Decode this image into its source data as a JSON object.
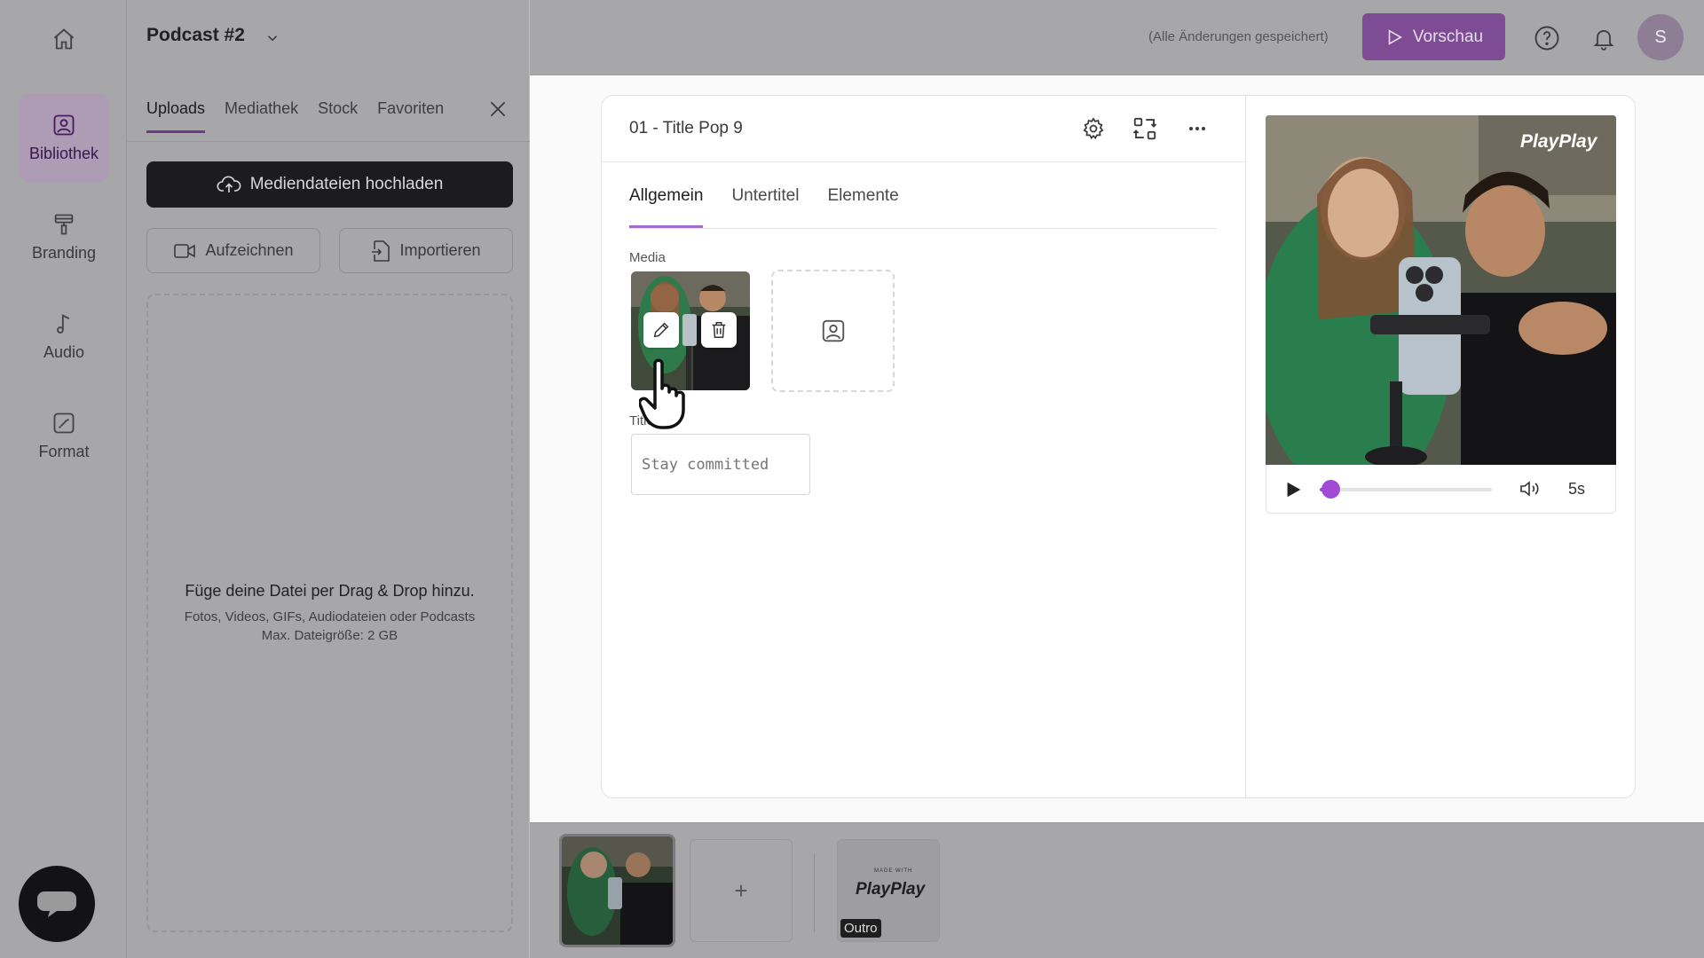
{
  "nav": {
    "home_icon": "home-icon",
    "items": [
      {
        "label": "Bibliothek",
        "icon": "library-icon",
        "active": true
      },
      {
        "label": "Branding",
        "icon": "paint-roller-icon"
      },
      {
        "label": "Audio",
        "icon": "music-note-icon"
      },
      {
        "label": "Format",
        "icon": "format-icon"
      }
    ],
    "chat_icon": "chat-bubble-icon"
  },
  "project": {
    "title": "Podcast #2"
  },
  "panel": {
    "tabs": [
      "Uploads",
      "Mediathek",
      "Stock",
      "Favoriten"
    ],
    "active_tab": "Uploads",
    "upload_label": "Mediendateien hochladen",
    "record_label": "Aufzeichnen",
    "import_label": "Importieren",
    "drop_title": "Füge deine Datei per Drag & Drop hinzu.",
    "drop_types": "Fotos, Videos, GIFs, Audiodateien oder Podcasts",
    "drop_max": "Max. Dateigröße: 2 GB"
  },
  "topbar": {
    "saved_status": "(Alle Änderungen gespeichert)",
    "preview_label": "Vorschau",
    "avatar_initial": "S"
  },
  "editor": {
    "scene_name": "01 - Title Pop 9",
    "tabs": [
      "Allgemein",
      "Untertitel",
      "Elemente"
    ],
    "active_tab": "Allgemein",
    "media_label": "Media",
    "title_label": "Title",
    "title_placeholder": "Stay committed"
  },
  "player": {
    "watermark": "PlayPlay",
    "duration": "5s",
    "progress": 0.02
  },
  "timeline": {
    "add_label": "+",
    "outro_logo": "PlayPlay",
    "outro_small": "MADE WITH",
    "outro_tag": "Outro"
  },
  "colors": {
    "accent": "#a24ad6",
    "preview_button": "#7e4b95",
    "dark_button": "#1c1c1f"
  }
}
